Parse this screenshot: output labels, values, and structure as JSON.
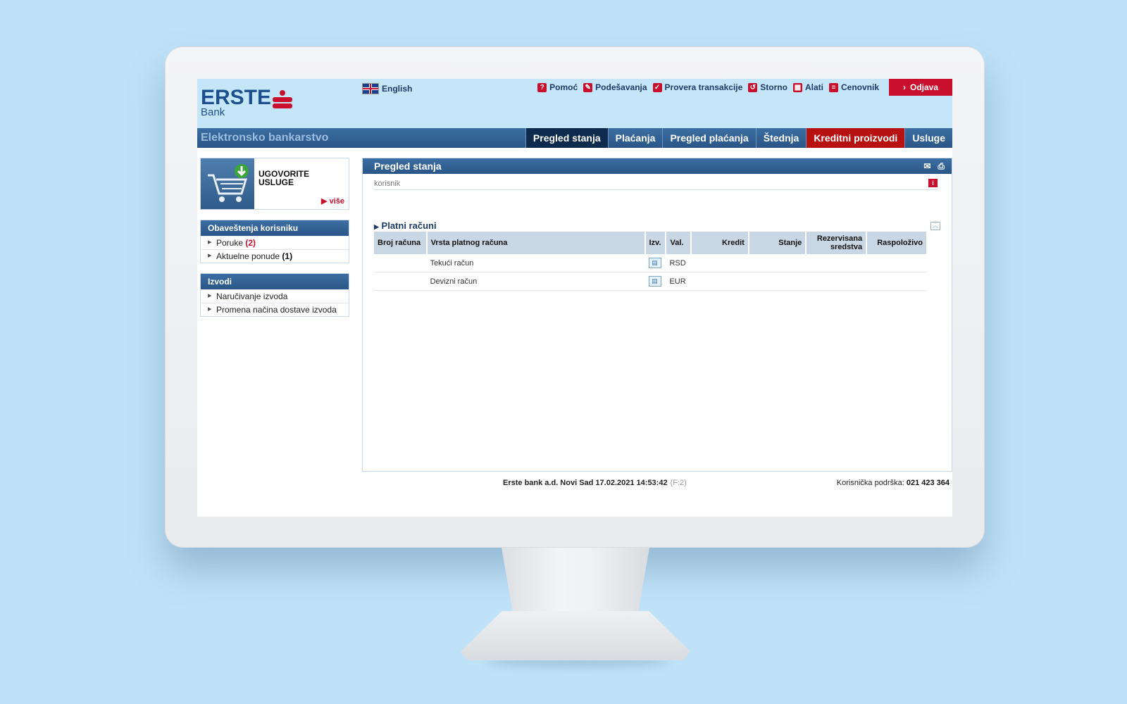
{
  "header": {
    "logo_name": "ERSTE",
    "logo_sub": "Bank",
    "language": "English",
    "links": [
      {
        "label": "Pomoć",
        "icon": "help-icon"
      },
      {
        "label": "Podešavanja",
        "icon": "wrench-icon"
      },
      {
        "label": "Provera transakcije",
        "icon": "check-icon"
      },
      {
        "label": "Storno",
        "icon": "storno-icon"
      },
      {
        "label": "Alati",
        "icon": "calculator-icon"
      },
      {
        "label": "Cenovnik",
        "icon": "price-list-icon"
      }
    ],
    "logout": "Odjava"
  },
  "nav": {
    "title": "Elektronsko bankarstvo",
    "tabs": [
      "Pregled stanja",
      "Plaćanja",
      "Pregled plaćanja",
      "Štednja",
      "Kreditni proizvodi",
      "Usluge"
    ]
  },
  "sidebar": {
    "promo": {
      "line1": "UGOVORITE",
      "line2": "USLUGE",
      "more": "više"
    },
    "notifications": {
      "title": "Obaveštenja korisniku",
      "items": [
        {
          "label": "Poruke",
          "count": "(2)"
        },
        {
          "label": "Aktuelne ponude",
          "count": "(1)"
        }
      ]
    },
    "statements": {
      "title": "Izvodi",
      "items": [
        "Naručivanje izvoda",
        "Promena načina dostave izvoda"
      ]
    }
  },
  "main": {
    "title": "Pregled stanja",
    "user_label": "korisnik",
    "section": "Platni računi",
    "columns": [
      "Broj računa",
      "Vrsta platnog računa",
      "Izv.",
      "Val.",
      "Kredit",
      "Stanje",
      "Rezervisana sredstva",
      "Raspoloživo"
    ],
    "rows": [
      {
        "number": "",
        "type": "Tekući račun",
        "currency": "RSD",
        "credit": "",
        "balance": "",
        "reserved": "",
        "available": ""
      },
      {
        "number": "",
        "type": "Devizni račun",
        "currency": "EUR",
        "credit": "",
        "balance": "",
        "reserved": "",
        "available": ""
      }
    ]
  },
  "footer": {
    "center": "Erste bank a.d. Novi Sad 17.02.2021 14:53:42",
    "code": "(F:2)",
    "support_label": "Korisnička podrška:",
    "support_phone": "021 423 364"
  },
  "colors": {
    "brand_blue": "#2a5687",
    "brand_red": "#c8102e",
    "background": "#bfe2f8"
  }
}
